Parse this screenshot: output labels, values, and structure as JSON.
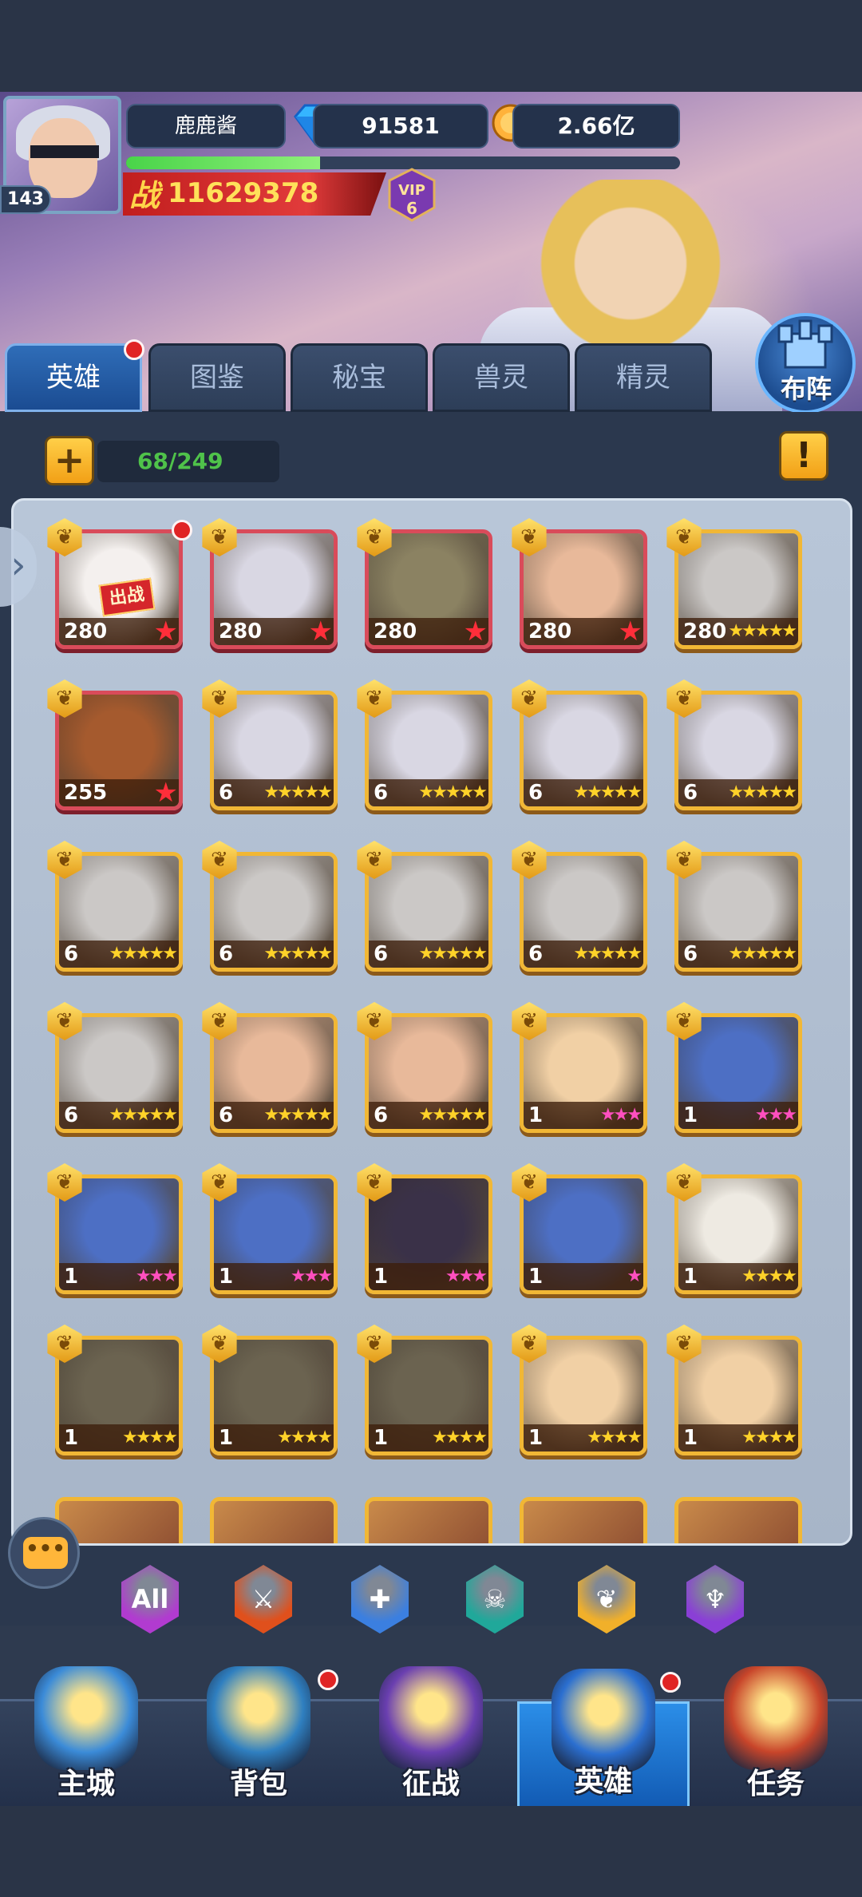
{
  "player": {
    "name": "鹿鹿酱",
    "level": "143",
    "diamonds": "91581",
    "gold": "2.66亿",
    "power_label": "战",
    "power": "11629378",
    "vip": "VIP",
    "vip_level": "6",
    "exp_fraction": 0.35
  },
  "tabs": [
    {
      "label": "英雄",
      "active": true,
      "dot": true
    },
    {
      "label": "图鉴"
    },
    {
      "label": "秘宝"
    },
    {
      "label": "兽灵"
    },
    {
      "label": "精灵"
    }
  ],
  "formation_label": "布阵",
  "hero_count": "68/249",
  "plus_label": "+",
  "info_label": "!",
  "deploy_tag": "出战",
  "heroes": [
    {
      "level": "280",
      "star_type": "red",
      "stars": "★",
      "card": "red",
      "bg": "#f4f0ee",
      "dot": true,
      "deployed": true
    },
    {
      "level": "280",
      "star_type": "red",
      "stars": "★",
      "card": "red",
      "bg": "#d9d7e3"
    },
    {
      "level": "280",
      "star_type": "red",
      "stars": "★",
      "card": "red",
      "bg": "#8b8262"
    },
    {
      "level": "280",
      "star_type": "red",
      "stars": "★",
      "card": "red",
      "bg": "#e8b99a"
    },
    {
      "level": "280",
      "star_type": "gold",
      "stars": "★★★★★",
      "card": "gold",
      "bg": "#cbc8c6"
    },
    {
      "level": "255",
      "star_type": "red",
      "stars": "★",
      "card": "red",
      "bg": "#a55a2e"
    },
    {
      "level": "6",
      "star_type": "gold",
      "stars": "★★★★★",
      "card": "gold",
      "bg": "#d9d7e3"
    },
    {
      "level": "6",
      "star_type": "gold",
      "stars": "★★★★★",
      "card": "gold",
      "bg": "#d9d7e3"
    },
    {
      "level": "6",
      "star_type": "gold",
      "stars": "★★★★★",
      "card": "gold",
      "bg": "#d9d7e3"
    },
    {
      "level": "6",
      "star_type": "gold",
      "stars": "★★★★★",
      "card": "gold",
      "bg": "#d9d7e3"
    },
    {
      "level": "6",
      "star_type": "gold",
      "stars": "★★★★★",
      "card": "gold",
      "bg": "#cbc8c6"
    },
    {
      "level": "6",
      "star_type": "gold",
      "stars": "★★★★★",
      "card": "gold",
      "bg": "#cbc8c6"
    },
    {
      "level": "6",
      "star_type": "gold",
      "stars": "★★★★★",
      "card": "gold",
      "bg": "#cbc8c6"
    },
    {
      "level": "6",
      "star_type": "gold",
      "stars": "★★★★★",
      "card": "gold",
      "bg": "#cbc8c6"
    },
    {
      "level": "6",
      "star_type": "gold",
      "stars": "★★★★★",
      "card": "gold",
      "bg": "#cbc8c6"
    },
    {
      "level": "6",
      "star_type": "gold",
      "stars": "★★★★★",
      "card": "gold",
      "bg": "#cbc8c6"
    },
    {
      "level": "6",
      "star_type": "gold",
      "stars": "★★★★★",
      "card": "gold",
      "bg": "#e8b99a"
    },
    {
      "level": "6",
      "star_type": "gold",
      "stars": "★★★★★",
      "card": "gold",
      "bg": "#e8b99a"
    },
    {
      "level": "1",
      "star_type": "pink",
      "stars": "★★★",
      "card": "gold",
      "bg": "#f1d0a5"
    },
    {
      "level": "1",
      "star_type": "pink",
      "stars": "★★★",
      "card": "gold",
      "bg": "#4d6fc4"
    },
    {
      "level": "1",
      "star_type": "pink",
      "stars": "★★★",
      "card": "gold",
      "bg": "#4d6fc4"
    },
    {
      "level": "1",
      "star_type": "pink",
      "stars": "★★★",
      "card": "gold",
      "bg": "#4d6fc4"
    },
    {
      "level": "1",
      "star_type": "pink",
      "stars": "★★★",
      "card": "gold",
      "bg": "#3a3148"
    },
    {
      "level": "1",
      "star_type": "pink",
      "stars": "★",
      "card": "gold",
      "bg": "#4d6fc4"
    },
    {
      "level": "1",
      "star_type": "gold",
      "stars": "★★★★",
      "card": "gold",
      "bg": "#eeeae2"
    },
    {
      "level": "1",
      "star_type": "gold",
      "stars": "★★★★",
      "card": "gold",
      "bg": "#6b6350"
    },
    {
      "level": "1",
      "star_type": "gold",
      "stars": "★★★★",
      "card": "gold",
      "bg": "#6b6350"
    },
    {
      "level": "1",
      "star_type": "gold",
      "stars": "★★★★",
      "card": "gold",
      "bg": "#6b6350"
    },
    {
      "level": "1",
      "star_type": "gold",
      "stars": "★★★★",
      "card": "gold",
      "bg": "#f1d0a5"
    },
    {
      "level": "1",
      "star_type": "gold",
      "stars": "★★★★",
      "card": "gold",
      "bg": "#f1d0a5"
    }
  ],
  "filters": [
    {
      "name": "filter-all",
      "label": "All",
      "color": "#b13bd0"
    },
    {
      "name": "filter-warrior",
      "label": "⚔",
      "color": "#e0501c"
    },
    {
      "name": "filter-mage",
      "label": "✚",
      "color": "#3b7fe0"
    },
    {
      "name": "filter-assassin",
      "label": "☠",
      "color": "#20a89a"
    },
    {
      "name": "filter-support",
      "label": "❦",
      "color": "#f1b02a"
    },
    {
      "name": "filter-tank",
      "label": "♆",
      "color": "#8a3fd6"
    }
  ],
  "nav": [
    {
      "label": "主城",
      "color": "#3b8bd8"
    },
    {
      "label": "背包",
      "color": "#2f7fc0",
      "dot": true
    },
    {
      "label": "征战",
      "color": "#6a3fb0"
    },
    {
      "label": "英雄",
      "color": "#2b6fd0",
      "active": true,
      "dot": true
    },
    {
      "label": "任务",
      "color": "#c8452a"
    }
  ]
}
